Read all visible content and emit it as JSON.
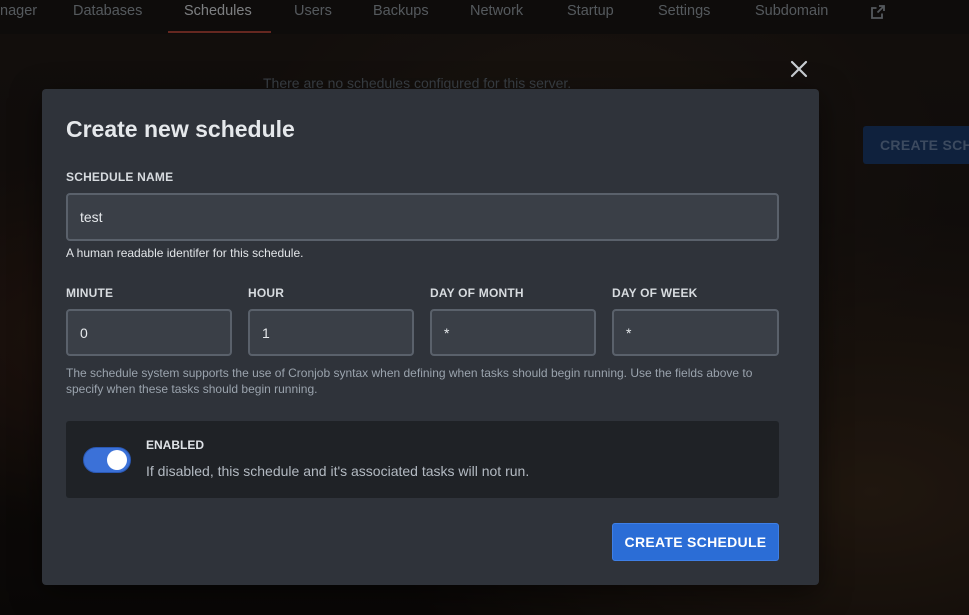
{
  "nav": {
    "items": [
      "nager",
      "Databases",
      "Schedules",
      "Users",
      "Backups",
      "Network",
      "Startup",
      "Settings",
      "Subdomain"
    ],
    "active": "Schedules",
    "external_icon": "external-link-icon"
  },
  "background": {
    "empty_message": "There are no schedules configured for this server.",
    "create_button_label": "CREATE SCHE"
  },
  "modal": {
    "title": "Create new schedule",
    "close_icon": "close-icon",
    "schedule_name": {
      "label": "SCHEDULE NAME",
      "value": "test",
      "help": "A human readable identifer for this schedule."
    },
    "cron": {
      "minute": {
        "label": "MINUTE",
        "value": "0"
      },
      "hour": {
        "label": "HOUR",
        "value": "1"
      },
      "day_of_month": {
        "label": "DAY OF MONTH",
        "value": "*"
      },
      "day_of_week": {
        "label": "DAY OF WEEK",
        "value": "*"
      },
      "help": "The schedule system supports the use of Cronjob syntax when defining when tasks should begin running. Use the fields above to specify when these tasks should begin running."
    },
    "enabled": {
      "label": "ENABLED",
      "description": "If disabled, this schedule and it's associated tasks will not run.",
      "on": true
    },
    "submit_label": "CREATE SCHEDULE"
  },
  "colors": {
    "accent": "#2b6dd6",
    "active_tab_underline": "#b9473b",
    "modal_bg": "#2f333a"
  }
}
